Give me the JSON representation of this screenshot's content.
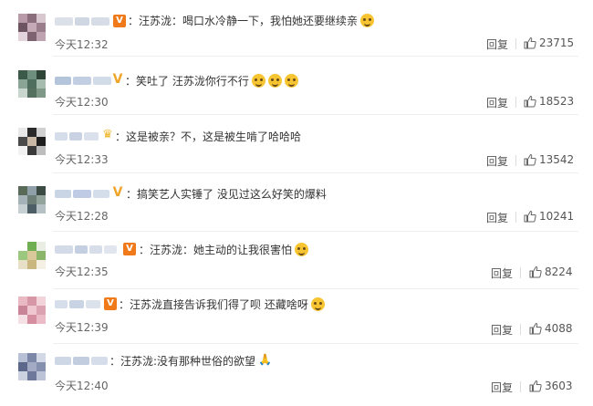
{
  "comments": [
    {
      "text": "：汪苏泷：喝口水冷静一下，我怕她还要继续亲",
      "time": "今天12:32",
      "reply": "回复",
      "likes": "23715"
    },
    {
      "text": "：笑吐了 汪苏泷你行不行",
      "time": "今天12:30",
      "reply": "回复",
      "likes": "18523"
    },
    {
      "text": "：这是被亲？不，这是被生啃了哈哈哈",
      "time": "今天12:33",
      "reply": "回复",
      "likes": "13542"
    },
    {
      "text": "：搞笑艺人实锤了 没见过这么好笑的爆料",
      "time": "今天12:28",
      "reply": "回复",
      "likes": "10241"
    },
    {
      "text": "：汪苏泷：她主动的让我很害怕",
      "time": "今天12:35",
      "reply": "回复",
      "likes": "8224"
    },
    {
      "text": "：汪苏泷直接告诉我们得了呗 还藏啥呀",
      "time": "今天12:39",
      "reply": "回复",
      "likes": "4088"
    },
    {
      "text": "：汪苏泷:没有那种世俗的欲望",
      "time": "今天12:40",
      "reply": "回复",
      "likes": "3603"
    }
  ]
}
